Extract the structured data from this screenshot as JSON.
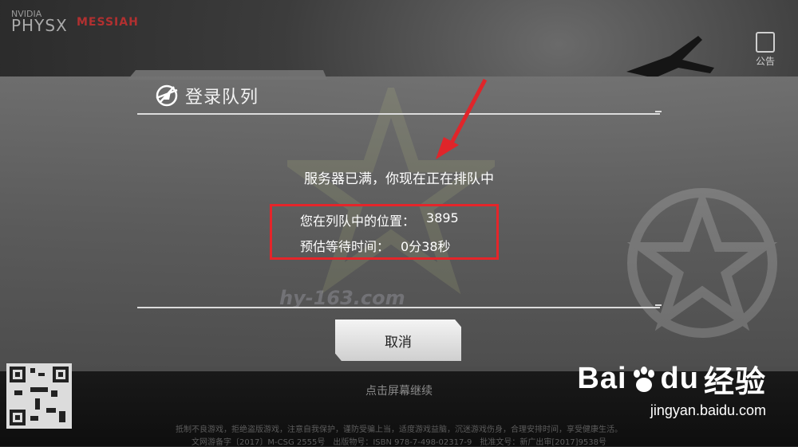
{
  "top_left": {
    "physx_label": "PHYSX",
    "physx_sub": "NVIDIA",
    "messiah_label": "MESSIAH"
  },
  "side": {
    "notice_label": "公告"
  },
  "dialog": {
    "title": "登录队列",
    "message": "服务器已满，你现在正在排队中",
    "queue_label": "您在列队中的位置：",
    "queue_value": "3895",
    "wait_label": "预估等待时间：",
    "wait_value": "0分38秒",
    "cancel_label": "取消"
  },
  "background": {
    "site_watermark": "hy-163.com",
    "continue_hint": "点击屏幕继续",
    "footer_line1": "抵制不良游戏，拒绝盗版游戏，注意自我保护，谨防受骗上当，适度游戏益脑，沉迷游戏伤身，合理安排时间，享受健康生活。",
    "footer_line2": "文网游备字〔2017〕M-CSG 2555号　出版物号：ISBN 978-7-498-02317-9　批准文号：新广出审[2017]9538号"
  },
  "watermark": {
    "brand": "Bai",
    "brand2": "du",
    "brand_cn": "经验",
    "url": "jingyan.baidu.com"
  },
  "colors": {
    "highlight_red": "#e5252a",
    "arrow_red": "#e0252a"
  },
  "icons": [
    "title-emblem-icon",
    "notice-icon",
    "baidu-paw-icon",
    "qr-code"
  ]
}
